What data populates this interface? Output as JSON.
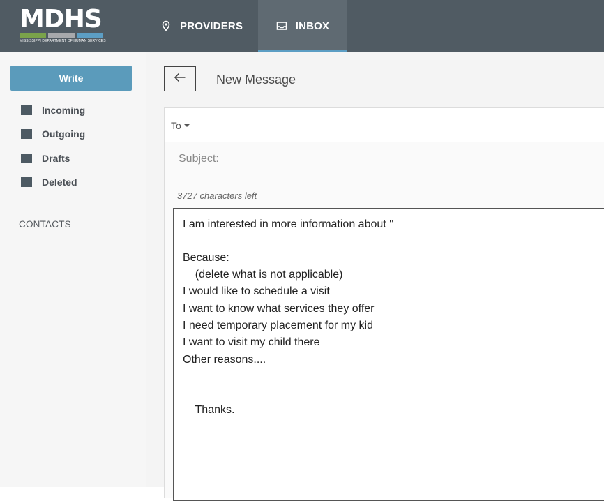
{
  "header": {
    "logo_text": "MDHS",
    "logo_subtitle": "MISSISSIPPI DEPARTMENT OF HUMAN SERVICES",
    "logo_bar_colors": [
      "#7aa34a",
      "#a7a9ac",
      "#5c9ec4"
    ],
    "nav": [
      {
        "label": "PROVIDERS",
        "icon": "map-pin-icon"
      },
      {
        "label": "INBOX",
        "icon": "inbox-icon",
        "active": true
      }
    ]
  },
  "sidebar": {
    "write_label": "Write",
    "folders": [
      {
        "label": "Incoming",
        "icon": "folder-icon"
      },
      {
        "label": "Outgoing",
        "icon": "folder-icon"
      },
      {
        "label": "Drafts",
        "icon": "folder-icon"
      },
      {
        "label": "Deleted",
        "icon": "folder-icon"
      }
    ],
    "contacts_label": "CONTACTS"
  },
  "main": {
    "back_icon": "arrow-left-icon",
    "title": "New Message",
    "to_label": "To",
    "subject_placeholder": "Subject:",
    "chars_left": "3727 characters left",
    "body_lines": [
      "I am interested in more information about ''",
      "",
      "Because:",
      "    (delete what is not applicable)",
      "I would like to schedule a visit",
      "I want to know what services they offer",
      "I need temporary placement for my kid",
      "I want to visit my child there",
      "Other reasons....",
      "",
      "",
      "    Thanks."
    ]
  },
  "colors": {
    "header_bg": "#505b63",
    "accent": "#5b9bbb",
    "active_underline": "#5c9ec4"
  }
}
